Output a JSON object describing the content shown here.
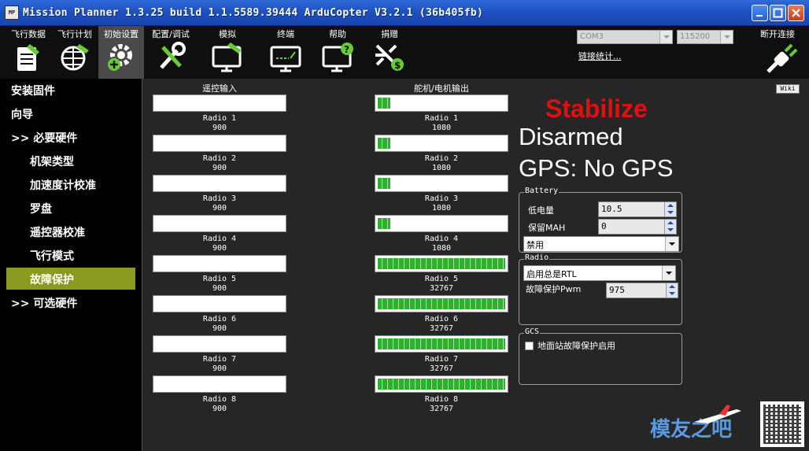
{
  "window": {
    "title": "Mission Planner 1.3.25 build 1.1.5589.39444 ArduCopter V3.2.1 (36b405fb)",
    "app_icon_text": "MP"
  },
  "toolbar": {
    "items": [
      {
        "label": "飞行数据",
        "icon": "flight-data-icon"
      },
      {
        "label": "飞行计划",
        "icon": "flight-plan-icon"
      },
      {
        "label": "初始设置",
        "icon": "initial-setup-icon"
      },
      {
        "label": "配置/调试",
        "icon": "config-tuning-icon"
      },
      {
        "label": "模拟",
        "icon": "simulation-icon"
      },
      {
        "label": "终端",
        "icon": "terminal-icon"
      },
      {
        "label": "帮助",
        "icon": "help-icon"
      },
      {
        "label": "捐赠",
        "icon": "donate-icon"
      }
    ],
    "port": "COM3",
    "baud": "115200",
    "link_stats": "链接统计...",
    "disconnect": "断开连接"
  },
  "sidebar": {
    "items": [
      {
        "label": "安装固件"
      },
      {
        "label": "向导"
      },
      {
        "label": ">> 必要硬件"
      },
      {
        "label": "机架类型"
      },
      {
        "label": "加速度计校准"
      },
      {
        "label": "罗盘"
      },
      {
        "label": "遥控器校准"
      },
      {
        "label": "飞行模式"
      },
      {
        "label": "故障保护"
      },
      {
        "label": ">> 可选硬件"
      }
    ],
    "active_index": 8
  },
  "rc_input": {
    "title": "遥控输入",
    "channels": [
      {
        "name": "Radio 1",
        "value": "900",
        "level": 0
      },
      {
        "name": "Radio 2",
        "value": "900",
        "level": 0
      },
      {
        "name": "Radio 3",
        "value": "900",
        "level": 0
      },
      {
        "name": "Radio 4",
        "value": "900",
        "level": 0
      },
      {
        "name": "Radio 5",
        "value": "900",
        "level": 0
      },
      {
        "name": "Radio 6",
        "value": "900",
        "level": 0
      },
      {
        "name": "Radio 7",
        "value": "900",
        "level": 0
      },
      {
        "name": "Radio 8",
        "value": "900",
        "level": 0
      }
    ]
  },
  "servo_output": {
    "title": "舵机/电机输出",
    "channels": [
      {
        "name": "Radio 1",
        "value": "1080",
        "level": 0.1
      },
      {
        "name": "Radio 2",
        "value": "1080",
        "level": 0.1
      },
      {
        "name": "Radio 3",
        "value": "1080",
        "level": 0.1
      },
      {
        "name": "Radio 4",
        "value": "1080",
        "level": 0.1
      },
      {
        "name": "Radio 5",
        "value": "32767",
        "level": 1
      },
      {
        "name": "Radio 6",
        "value": "32767",
        "level": 1
      },
      {
        "name": "Radio 7",
        "value": "32767",
        "level": 1
      },
      {
        "name": "Radio 8",
        "value": "32767",
        "level": 1
      }
    ]
  },
  "status": {
    "mode": "Stabilize",
    "armed": "Disarmed",
    "gps": "GPS: No GPS",
    "mode_color": "#e01010"
  },
  "battery": {
    "legend": "Battery",
    "low_voltage_label": "低电量",
    "low_voltage_value": "10.5",
    "reserve_mah_label": "保留MAH",
    "reserve_mah_value": "0",
    "action": "禁用"
  },
  "radio": {
    "legend": "Radio",
    "action": "启用总是RTL",
    "pwm_label": "故障保护Pwm",
    "pwm_value": "975"
  },
  "gcs": {
    "legend": "GCS",
    "checkbox_label": "地面站故障保护启用"
  },
  "wiki": "Wiki",
  "watermark": "模友之吧"
}
